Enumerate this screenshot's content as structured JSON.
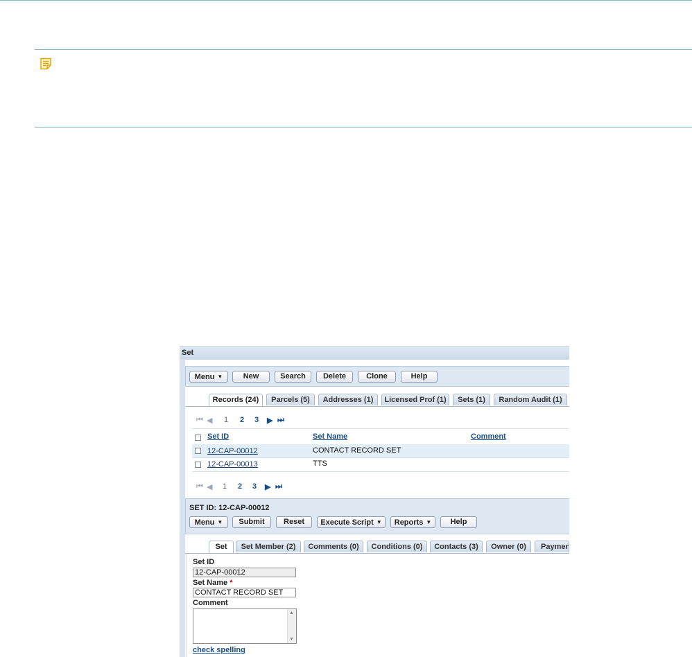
{
  "window": {
    "title": "Set"
  },
  "toolbar_top": {
    "menu": "Menu",
    "new": "New",
    "search": "Search",
    "delete": "Delete",
    "clone": "Clone",
    "help": "Help"
  },
  "tabs_top": [
    "Records (24)",
    "Parcels (5)",
    "Addresses (1)",
    "Licensed Prof (1)",
    "Sets (1)",
    "Random Audit (1)"
  ],
  "pager": {
    "pages": [
      "1",
      "2",
      "3"
    ]
  },
  "table": {
    "headers": {
      "set_id": "Set ID",
      "set_name": "Set Name",
      "comment": "Comment"
    },
    "rows": [
      {
        "set_id": "12-CAP-00012",
        "set_name": "CONTACT RECORD SET",
        "comment": ""
      },
      {
        "set_id": "12-CAP-00013",
        "set_name": "TTS",
        "comment": ""
      }
    ]
  },
  "detail": {
    "header": "SET ID: 12-CAP-00012",
    "toolbar": {
      "menu": "Menu",
      "submit": "Submit",
      "reset": "Reset",
      "execute_script": "Execute Script",
      "reports": "Reports",
      "help": "Help"
    },
    "tabs": [
      "Set",
      "Set Member (2)",
      "Comments (0)",
      "Conditions (0)",
      "Contacts (3)",
      "Owner (0)",
      "Paymen"
    ],
    "form": {
      "set_id_label": "Set ID",
      "set_id_value": "12-CAP-00012",
      "set_name_label": "Set Name",
      "required_mark": "*",
      "set_name_value": "CONTACT RECORD SET",
      "comment_label": "Comment",
      "check_spelling": "check spelling"
    }
  },
  "colors": {
    "divider": "#7fb7c2",
    "panel": "#dde8f3",
    "link": "#1b4f8a",
    "selected_row": "#e2eef8"
  },
  "icons": {
    "note": "note-icon"
  }
}
